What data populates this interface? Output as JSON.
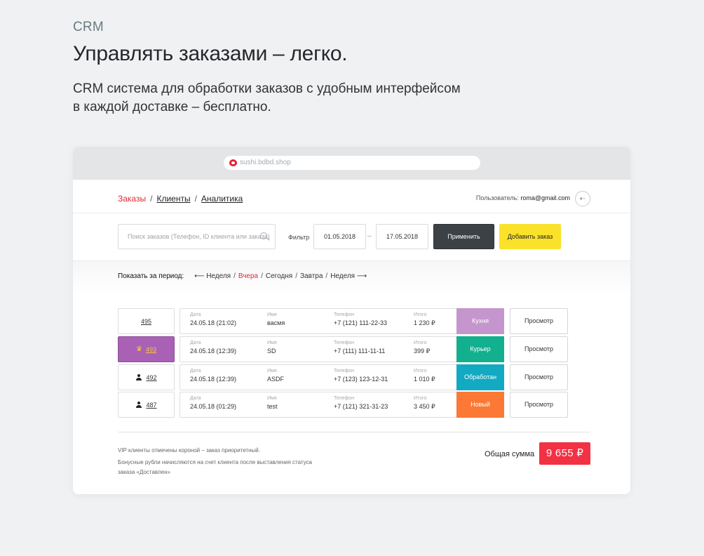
{
  "promo": {
    "eyebrow": "CRM",
    "headline": "Управлять заказами – легко.",
    "lede_line1": "CRM система для обработки заказов с удобным интерфейсом",
    "lede_line2": "в каждой доставке – бесплатно."
  },
  "browser": {
    "url": "sushi.bdbd.shop"
  },
  "nav": {
    "orders": "Заказы",
    "separator": "/",
    "clients": "Клиенты",
    "analytics": "Аналитика"
  },
  "user": {
    "label": "Пользователь:",
    "email": "roma@gmail.com",
    "logout_icon": "⇠"
  },
  "filters": {
    "search_placeholder": "Поиск заказов (Телефон, ID клиента или заказа)",
    "filter_label": "Фильтр",
    "date_from": "01.05.2018",
    "date_sep": "–",
    "date_to": "17.05.2018",
    "apply_label": "Применить",
    "add_label": "Добавить заказ"
  },
  "period": {
    "label": "Показать за период:",
    "arrow_left": "⟵",
    "arrow_right": "⟶",
    "options": [
      "Неделя",
      "Вчера",
      "Сегодня",
      "Завтра",
      "Неделя"
    ],
    "active_index": 1,
    "separator": "/"
  },
  "columns": {
    "date": "Дата",
    "name": "Имя",
    "phone": "Телефон",
    "total": "Итого"
  },
  "orders": [
    {
      "id": "495",
      "marker": "none",
      "date": "24.05.18 (21:02)",
      "name": "васмя",
      "phone": "+7 (121) 111-22-33",
      "total": "1 230 ₽",
      "status": "Кухня",
      "status_color": "#c596cd",
      "view": "Просмотр"
    },
    {
      "id": "493",
      "marker": "crown",
      "date": "24.05.18 (12:39)",
      "name": "SD",
      "phone": "+7 (111) 111-11-11",
      "total": "399 ₽",
      "status": "Курьер",
      "status_color": "#12b08e",
      "view": "Просмотр"
    },
    {
      "id": "492",
      "marker": "person",
      "date": "24.05.18 (12:39)",
      "name": "ASDF",
      "phone": "+7 (123) 123-12-31",
      "total": "1 010 ₽",
      "status": "Обработан",
      "status_color": "#12a9c2",
      "view": "Просмотр"
    },
    {
      "id": "487",
      "marker": "person",
      "date": "24.05.18 (01:29)",
      "name": "test",
      "phone": "+7 (121) 321-31-23",
      "total": "3 450 ₽",
      "status": "Новый",
      "status_color": "#fb7935",
      "view": "Просмотр"
    }
  ],
  "footer": {
    "note_vip": "VIP клиенты отмечены короной – заказ приоритетный.",
    "note_bonus": "Бонусные рубли начисляются на счет клиента после выставления статуса заказа «Доставлен»",
    "total_label": "Общая сумма",
    "total_value": "9 655 ₽"
  },
  "colors": {
    "accent_red": "#e02a34",
    "apply_bg": "#3b4145",
    "add_bg": "#fbe22a",
    "total_bg": "#f23145",
    "vip_bg": "#a961b5",
    "crown": "#f8c93a"
  },
  "icons": {
    "url": "site-favicon",
    "search": "search-icon",
    "logout": "logout-icon",
    "vip": "crown-icon",
    "regular_client": "person-icon"
  }
}
